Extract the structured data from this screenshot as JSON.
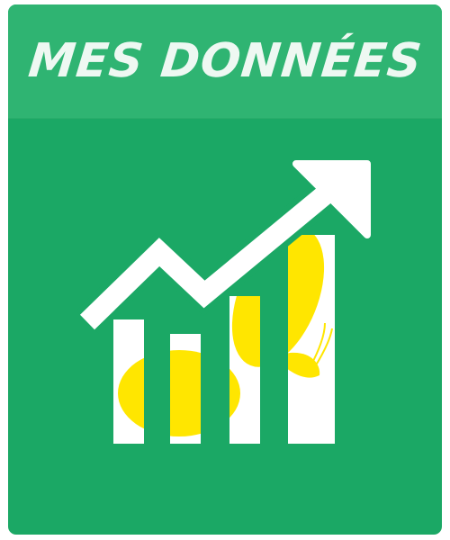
{
  "tile": {
    "title": "MES DONNÉES",
    "icon": "growth-chart-icon",
    "colors": {
      "tile_background": "#1ba865",
      "header_background": "#2fb472",
      "title_text": "#eef8f2",
      "icon_primary": "#ffffff",
      "icon_accent": "#ffe600"
    }
  }
}
